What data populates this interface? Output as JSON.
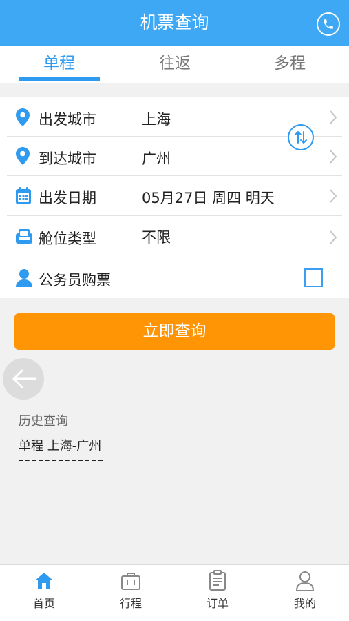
{
  "header": {
    "title": "机票查询",
    "phone_icon": "phone-icon"
  },
  "tabs": [
    {
      "label": "单程",
      "active": true
    },
    {
      "label": "往返",
      "active": false
    },
    {
      "label": "多程",
      "active": false
    }
  ],
  "form": {
    "departure": {
      "label": "出发城市",
      "value": "上海",
      "icon": "location-pin-icon"
    },
    "arrival": {
      "label": "到达城市",
      "value": "广州",
      "icon": "location-pin-icon"
    },
    "date": {
      "label": "出发日期",
      "value": "05月27日 周四 明天",
      "icon": "calendar-icon"
    },
    "cabin": {
      "label": "舱位类型",
      "value": "不限",
      "icon": "seat-icon"
    },
    "civil_servant": {
      "label": "公务员购票",
      "checked": false,
      "icon": "person-icon"
    },
    "swap_icon": "swap-icon"
  },
  "search_button": {
    "label": "立即查询"
  },
  "history": {
    "title": "历史查询",
    "items": [
      "单程  上海-广州"
    ]
  },
  "tabbar": [
    {
      "label": "首页",
      "icon": "home-icon",
      "active": true
    },
    {
      "label": "行程",
      "icon": "briefcase-icon",
      "active": false
    },
    {
      "label": "订单",
      "icon": "order-icon",
      "active": false
    },
    {
      "label": "我的",
      "icon": "user-icon",
      "active": false
    }
  ],
  "colors": {
    "primary": "#3ea8f4",
    "accent": "#ff9504",
    "tab_active": "#2f9bf0"
  }
}
